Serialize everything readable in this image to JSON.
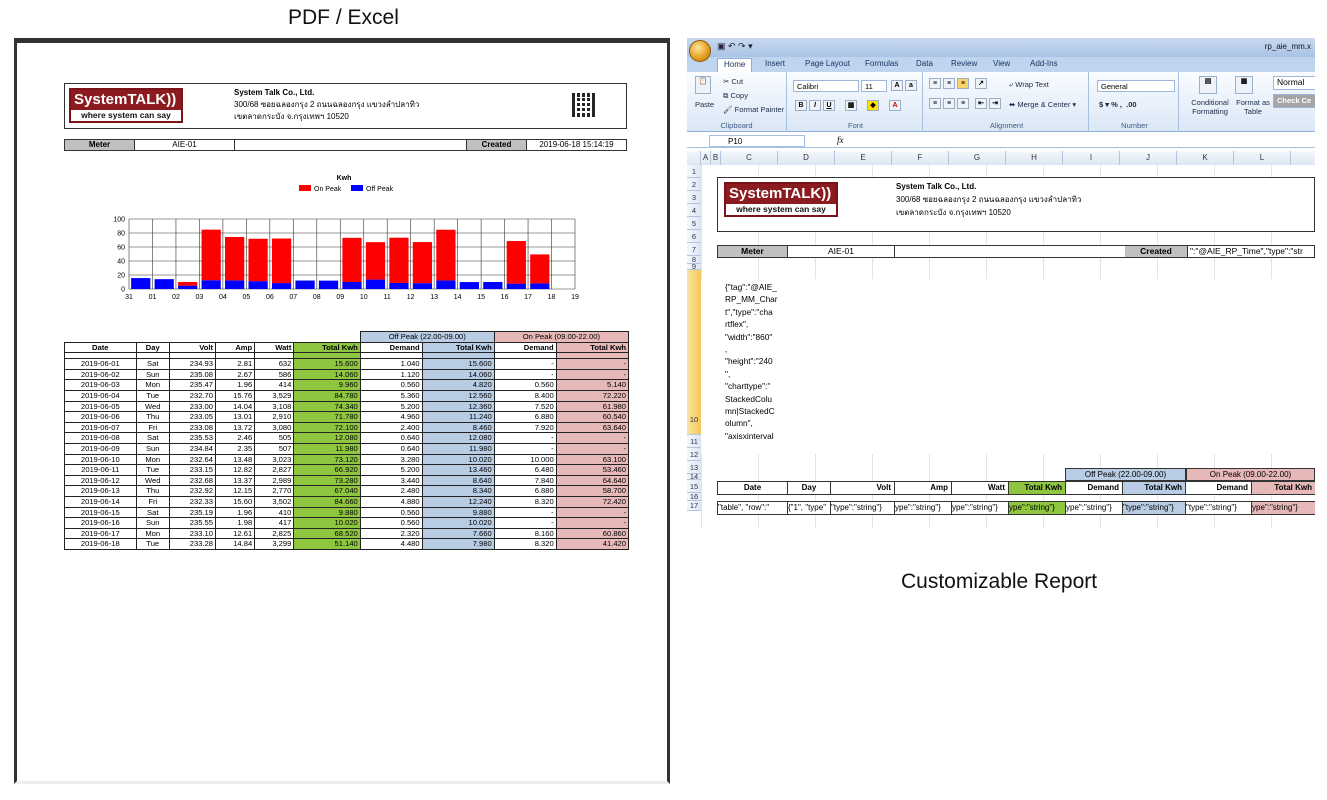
{
  "captions": {
    "left": "PDF / Excel",
    "right": "Customizable Report"
  },
  "company": {
    "logo_main": "SystemTALK",
    "logo_waves": "))",
    "logo_tag": "where system can say",
    "pdf_name": "System Talk Co., Ltd.",
    "excel_name": "System Talk Co., Ltd.",
    "address1": "300/68 ซอยฉลองกรุง 2 ถนนฉลองกรุง แขวงลำปลาทิว",
    "address2": "เขตลาดกระบัง จ.กรุงเทพฯ 10520"
  },
  "meter": {
    "label": "Meter",
    "value": "AIE-01",
    "created_label": "Created",
    "created_value": "2019-06-18 15:14:19"
  },
  "chart_data": {
    "type": "bar",
    "stacked": true,
    "title": "Kwh",
    "legend_position": "top-center",
    "categories": [
      "31",
      "01",
      "02",
      "03",
      "04",
      "05",
      "06",
      "07",
      "08",
      "09",
      "10",
      "11",
      "12",
      "13",
      "14",
      "15",
      "16",
      "17",
      "18",
      "19"
    ],
    "ylim": [
      0,
      100
    ],
    "yticks": [
      0,
      20,
      40,
      60,
      80,
      100
    ],
    "grid": true,
    "series": [
      {
        "name": "Off Peak",
        "color": "#0000ff",
        "values": [
          0,
          15.6,
          14.06,
          4.82,
          12.56,
          12.36,
          11.24,
          8.46,
          12.08,
          11.98,
          10.02,
          13.46,
          8.64,
          8.34,
          12.24,
          9.88,
          10.02,
          7.66,
          7.98,
          0
        ]
      },
      {
        "name": "On Peak",
        "color": "#ff0000",
        "values": [
          0,
          0,
          0,
          5.14,
          72.22,
          61.98,
          60.54,
          63.64,
          0,
          0,
          63.1,
          53.46,
          64.64,
          58.7,
          72.42,
          0,
          0,
          60.86,
          41.42,
          0
        ]
      }
    ]
  },
  "table": {
    "group_off": "Off Peak (22.00-09.00)",
    "group_on": "On Peak (09.00-22.00)",
    "headers": [
      "Date",
      "Day",
      "Volt",
      "Amp",
      "Watt",
      "Total Kwh",
      "Demand",
      "Total Kwh",
      "Demand",
      "Total Kwh"
    ],
    "rows": [
      [
        "2019-06-01",
        "Sat",
        "234.93",
        "2.81",
        "632",
        "15.600",
        "1.040",
        "15.600",
        "-",
        "-"
      ],
      [
        "2019-06-02",
        "Sun",
        "235.08",
        "2.67",
        "586",
        "14.060",
        "1.120",
        "14.060",
        "-",
        "-"
      ],
      [
        "2019-06-03",
        "Mon",
        "235.47",
        "1.96",
        "414",
        "9.960",
        "0.560",
        "4.820",
        "0.560",
        "5.140"
      ],
      [
        "2019-06-04",
        "Tue",
        "232.70",
        "15.76",
        "3,529",
        "84.780",
        "5.360",
        "12.560",
        "8.400",
        "72.220"
      ],
      [
        "2019-06-05",
        "Wed",
        "233.00",
        "14.04",
        "3,108",
        "74.340",
        "5.200",
        "12.360",
        "7.520",
        "61.980"
      ],
      [
        "2019-06-06",
        "Thu",
        "233.05",
        "13.01",
        "2,910",
        "71.780",
        "4.960",
        "11.240",
        "6.880",
        "60.540"
      ],
      [
        "2019-06-07",
        "Fri",
        "233.08",
        "13.72",
        "3,080",
        "72.100",
        "2.400",
        "8.460",
        "7.920",
        "63.640"
      ],
      [
        "2019-06-08",
        "Sat",
        "235.53",
        "2.46",
        "505",
        "12.080",
        "0.640",
        "12.080",
        "-",
        "-"
      ],
      [
        "2019-06-09",
        "Sun",
        "234.84",
        "2.35",
        "507",
        "11.980",
        "0.640",
        "11.980",
        "-",
        "-"
      ],
      [
        "2019-06-10",
        "Mon",
        "232.64",
        "13.48",
        "3,023",
        "73.120",
        "3.280",
        "10.020",
        "10.000",
        "63.100"
      ],
      [
        "2019-06-11",
        "Tue",
        "233.15",
        "12.82",
        "2,827",
        "66.920",
        "5.200",
        "13.460",
        "6.480",
        "53.460"
      ],
      [
        "2019-06-12",
        "Wed",
        "232.68",
        "13.37",
        "2,989",
        "73.280",
        "3.440",
        "8.640",
        "7.840",
        "64.640"
      ],
      [
        "2019-06-13",
        "Thu",
        "232.92",
        "12.15",
        "2,770",
        "67.040",
        "2.480",
        "8.340",
        "6.880",
        "58.700"
      ],
      [
        "2019-06-14",
        "Fri",
        "232.33",
        "15.60",
        "3,502",
        "84.660",
        "4.880",
        "12.240",
        "8.320",
        "72.420"
      ],
      [
        "2019-06-15",
        "Sat",
        "235.19",
        "1.96",
        "410",
        "9.880",
        "0.560",
        "9.880",
        "-",
        "-"
      ],
      [
        "2019-06-16",
        "Sun",
        "235.55",
        "1.98",
        "417",
        "10.020",
        "0.560",
        "10.020",
        "-",
        "-"
      ],
      [
        "2019-06-17",
        "Mon",
        "233.10",
        "12.61",
        "2,825",
        "68.520",
        "2.320",
        "7.660",
        "8.160",
        "60.860"
      ],
      [
        "2019-06-18",
        "Tue",
        "233.28",
        "14.84",
        "3,299",
        "51.140",
        "4.480",
        "7.980",
        "8.320",
        "41.420"
      ]
    ]
  },
  "excel": {
    "window_title": "rp_aie_mm.x",
    "tabs": [
      "Home",
      "Insert",
      "Page Layout",
      "Formulas",
      "Data",
      "Review",
      "View",
      "Add-Ins"
    ],
    "clipboard": {
      "paste": "Paste",
      "cut": "Cut",
      "copy": "Copy",
      "format_painter": "Format Painter",
      "label": "Clipboard"
    },
    "font": {
      "name": "Calibri",
      "size": "11",
      "label": "Font"
    },
    "alignment": {
      "wrap": "Wrap Text",
      "merge": "Merge & Center",
      "label": "Alignment"
    },
    "number": {
      "format": "General",
      "label": "Number"
    },
    "styles": {
      "cond": "Conditional Formatting",
      "fmt_table": "Format as Table",
      "normal": "Normal",
      "check": "Check Ce"
    },
    "name_box": "P10",
    "fx": "fx",
    "columns": [
      "A",
      "B",
      "C",
      "D",
      "E",
      "F",
      "G",
      "H",
      "I",
      "J",
      "K",
      "L"
    ],
    "rows": [
      "1",
      "2",
      "3",
      "4",
      "5",
      "6",
      "7",
      "8",
      "9",
      "10",
      "11",
      "12",
      "13",
      "14",
      "15",
      "16",
      "17"
    ],
    "created_template": "\":\"@AIE_RP_Time\",\"type\":\"str",
    "chart_json_lines": [
      "{\"tag\":\"@AIE_",
      "RP_MM_Char",
      "t\",\"type\":\"cha",
      "rtflex\",",
      "\"width\":\"860\"",
      ",",
      "\"height\":\"240",
      "\",",
      "\"charttype\":\"",
      "StackedColu",
      "mn|StackedC",
      "olumn\",",
      "\"axisxinterval"
    ],
    "row15": [
      "\"table\", \"row\":\"",
      "{\"1\", \"type\"",
      "\"type\":\"string\"}",
      "ype\":\"string\"}",
      "ype\":\"string\"}",
      "ype\":\"string\"}",
      "ype\":\"string\"}",
      "\"type\":\"string\"}",
      "\"type\":\"string\"}",
      "ype\":\"string\"}"
    ]
  },
  "colors": {
    "accent_green": "#8ec63f",
    "off_peak_blue": "#b8cce4",
    "on_peak_pink": "#e6b8b7",
    "logo_red": "#8c1b1f"
  }
}
